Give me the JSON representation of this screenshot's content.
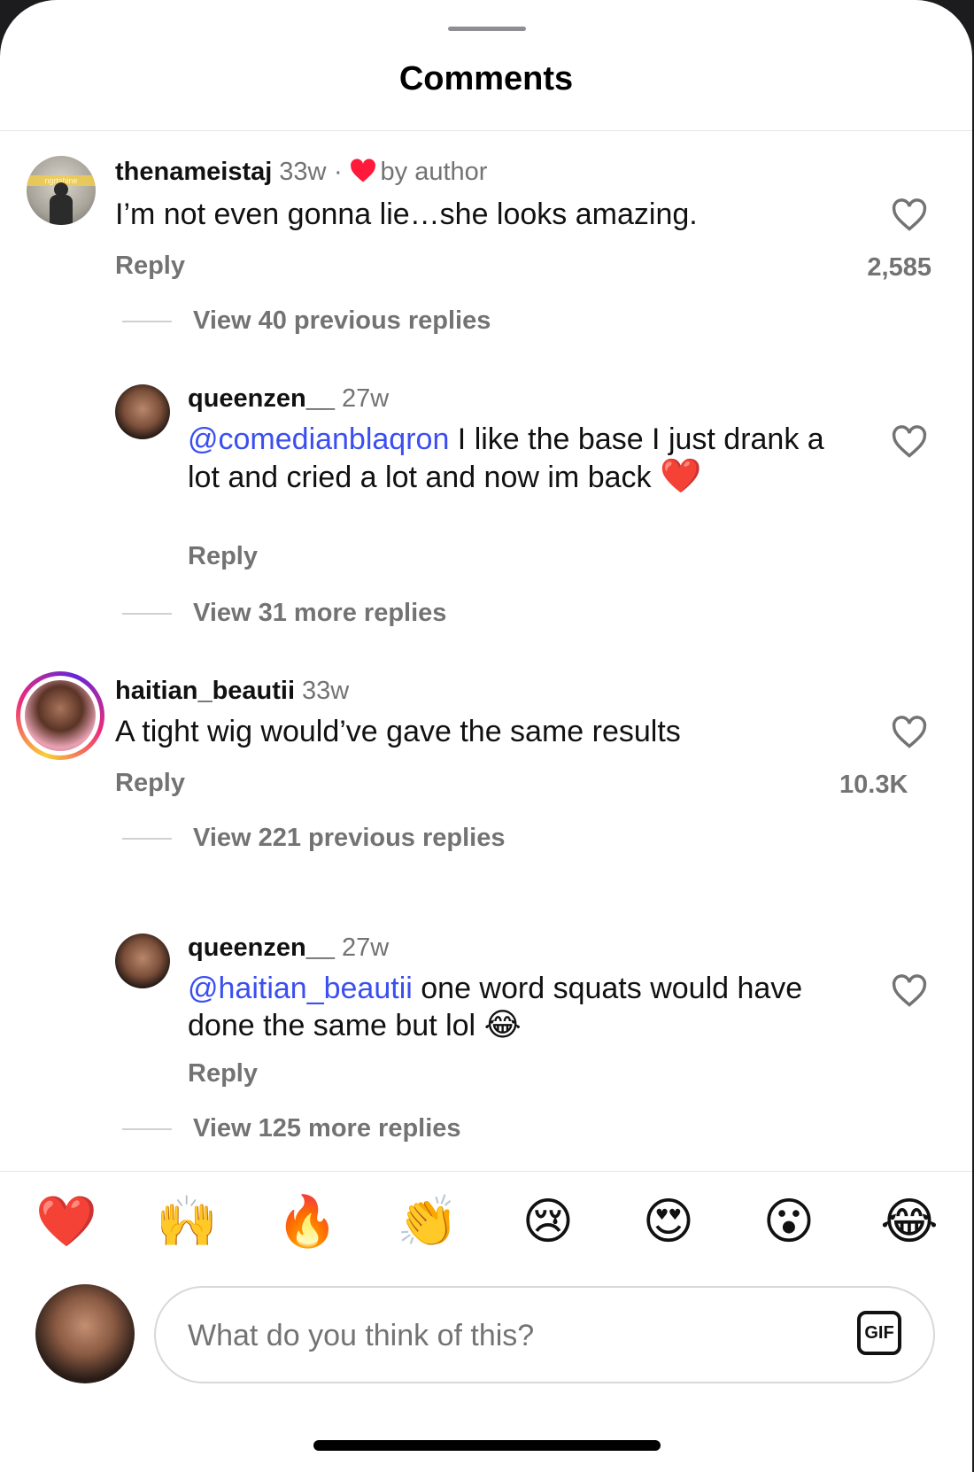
{
  "sheet": {
    "title": "Comments"
  },
  "comments": [
    {
      "username": "thenameistaj",
      "time": "33w",
      "author_like_label": "by author",
      "author_like_separator": "·",
      "text": "I’m not even gonna lie…she looks amazing.",
      "reply_label": "Reply",
      "like_count": "2,585",
      "view_replies": "View 40 previous replies",
      "avatar_banner": "ngrtshine"
    },
    {
      "username": "queenzen__",
      "time": "27w",
      "mention": "@comedianblaqron",
      "text": " I like the base I just drank a lot and cried a lot and now im back ",
      "emoji": "❤️",
      "reply_label": "Reply",
      "view_replies": "View 31 more replies"
    },
    {
      "username": "haitian_beautii",
      "time": "33w",
      "text": "A tight wig would’ve gave the same results",
      "reply_label": "Reply",
      "like_count": "10.3K",
      "view_replies": "View 221 previous replies"
    },
    {
      "username": "queenzen__",
      "time": "27w",
      "mention": "@haitian_beautii",
      "text": " one word squats would have done the same but lol ",
      "emoji": "😂",
      "reply_label": "Reply",
      "view_replies": "View 125 more replies"
    }
  ],
  "quick_reactions": [
    "❤️",
    "🙌",
    "🔥",
    "👏",
    "😢",
    "😍",
    "😮",
    "😂"
  ],
  "composer": {
    "placeholder": "What do you think of this?",
    "gif_label": "GIF"
  },
  "colors": {
    "mention": "#3b4ef0",
    "author_heart": "#ff1a3c",
    "secondary_text": "#737373",
    "story_ring": [
      "#f9ce34",
      "#ee2a7b",
      "#6228d7"
    ]
  }
}
